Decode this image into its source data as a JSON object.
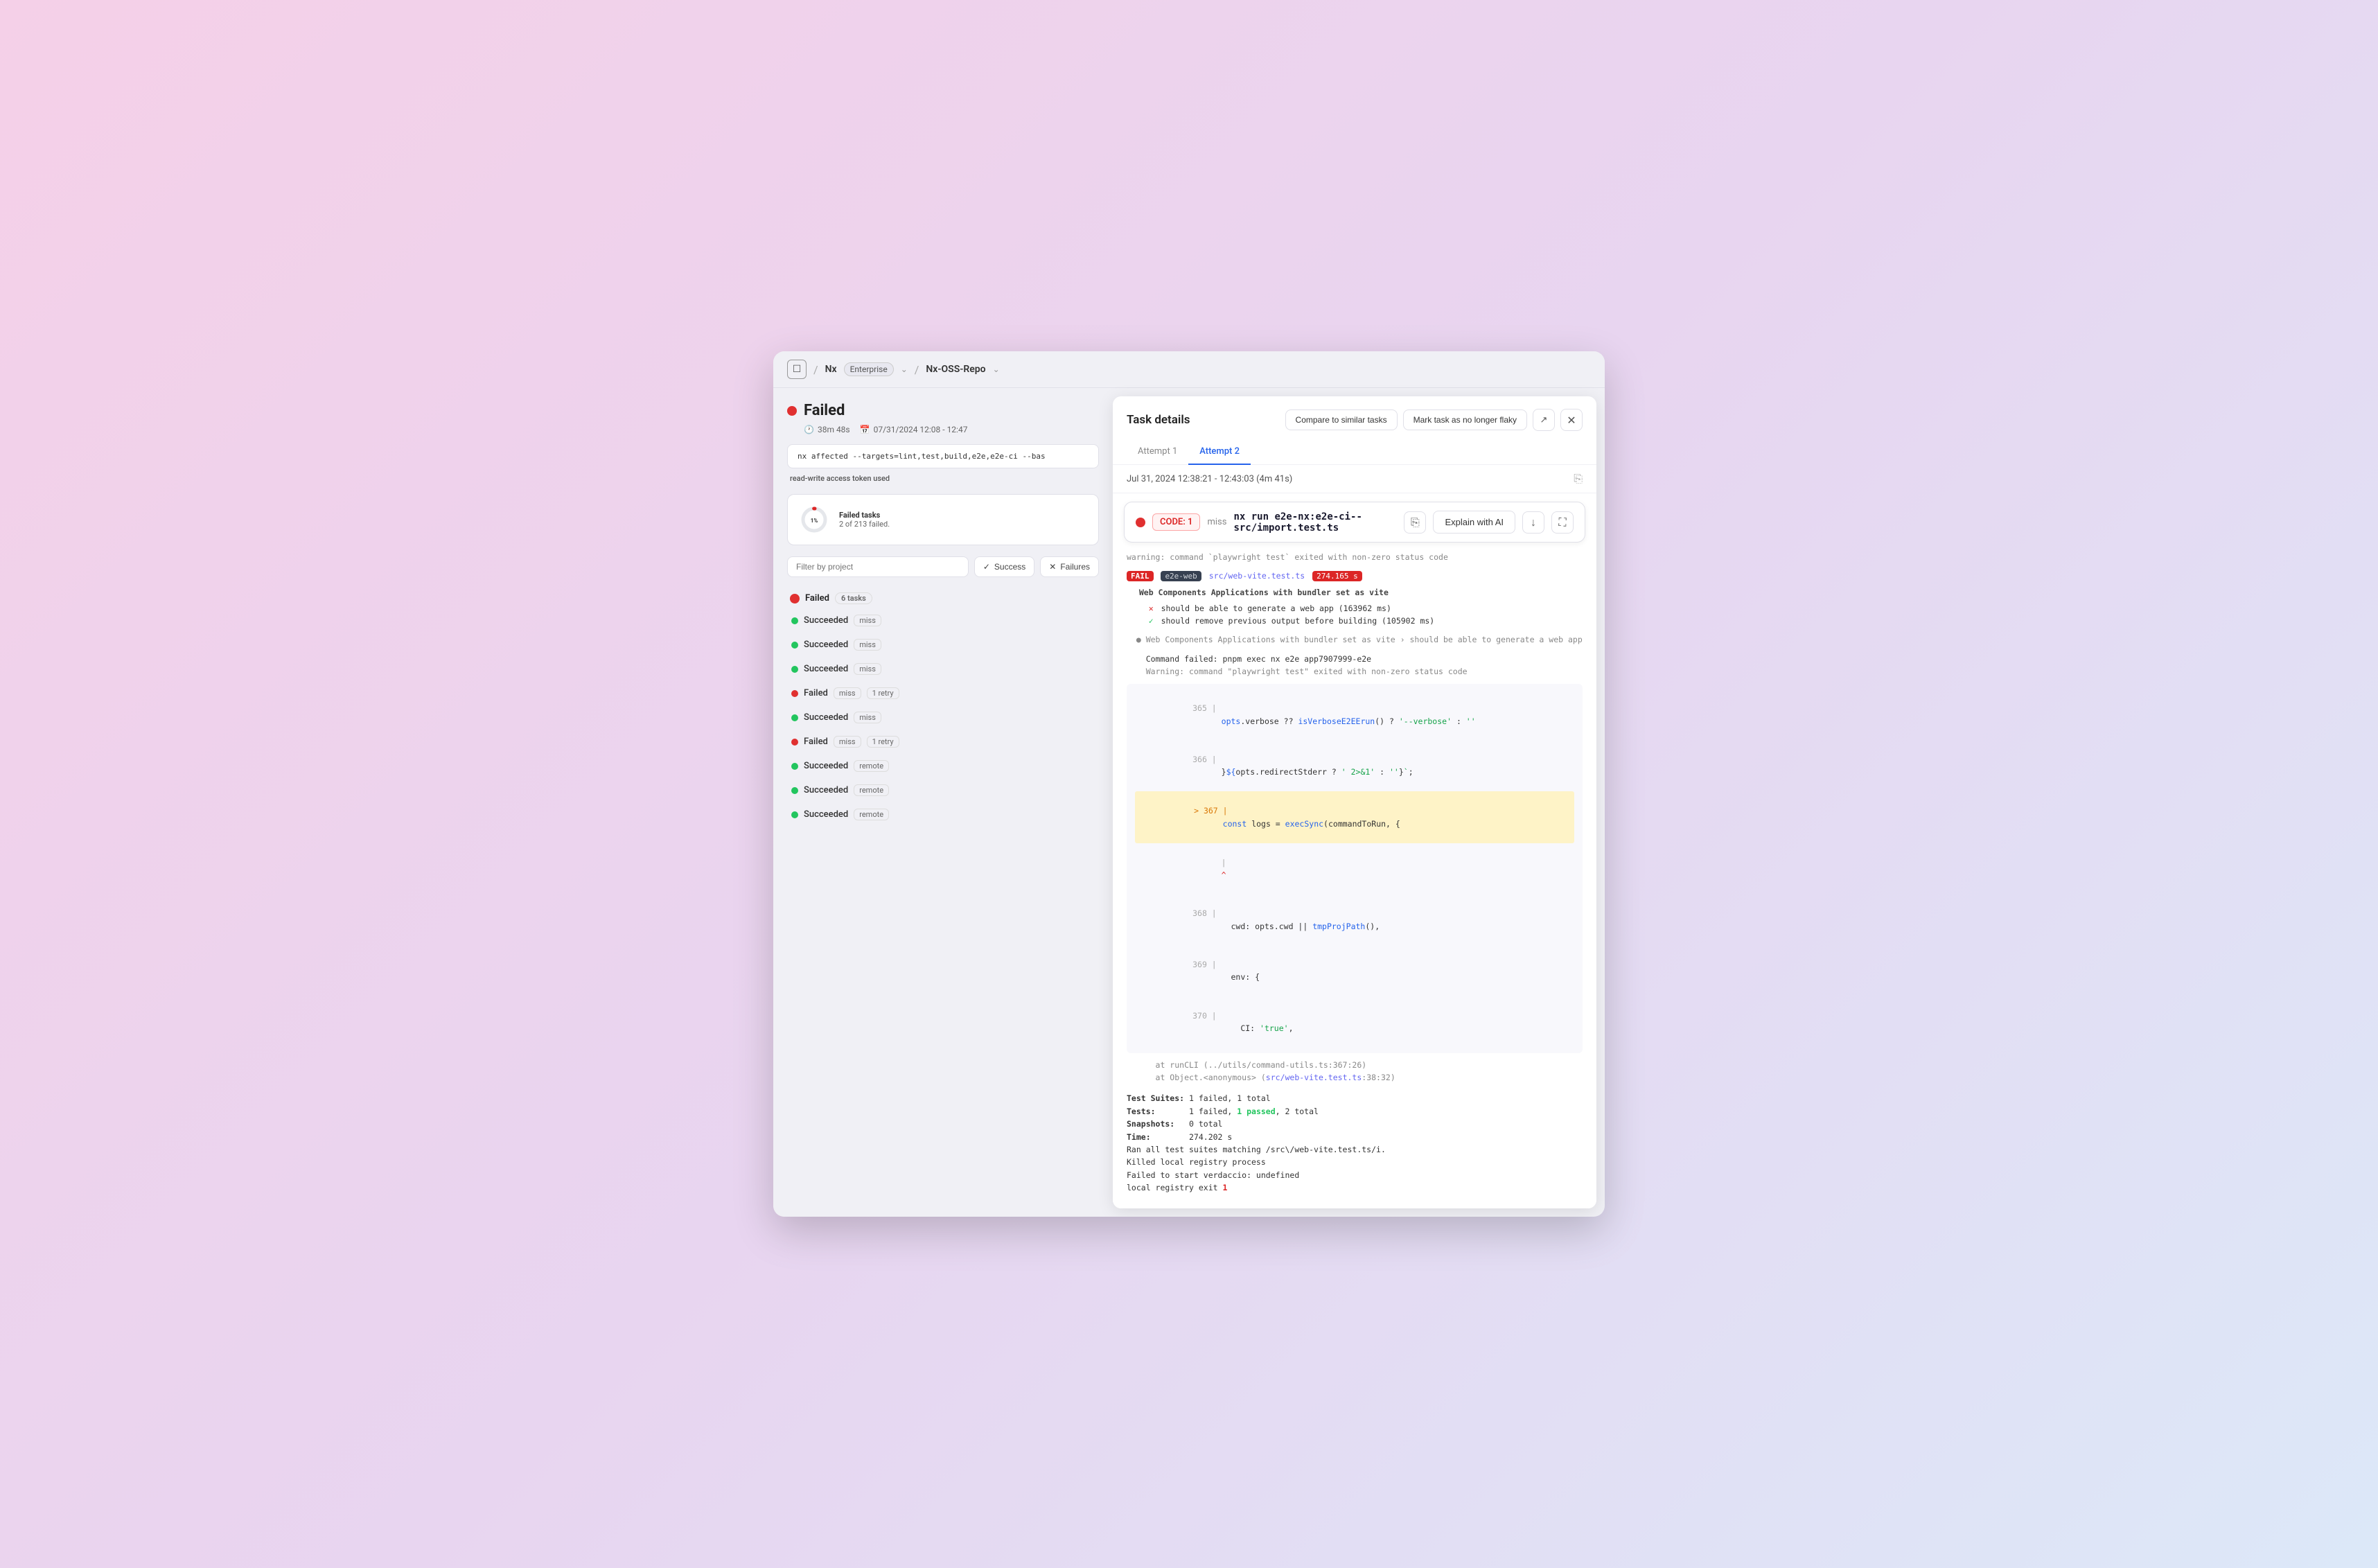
{
  "header": {
    "logo_label": "☐",
    "sep1": "/",
    "nx_label": "Nx",
    "nx_badge": "Enterprise",
    "sep2": "/",
    "repo_label": "Nx-OSS-Repo",
    "chevron": "⌄"
  },
  "pipeline": {
    "status": "Failed",
    "duration": "38m 48s",
    "date": "07/31/2024 12:08 - 12:47",
    "command": "nx affected --targets=lint,test,build,e2e,e2e-ci --bas",
    "token_info": "read-write access token used"
  },
  "failed_tasks": {
    "percent": "1%",
    "title": "Failed tasks",
    "subtitle": "2 of 213 failed."
  },
  "filters": {
    "placeholder": "Filter by project",
    "success_label": "Success",
    "failures_label": "Failures"
  },
  "task_list": {
    "section_label": "Failed",
    "task_count": "6 tasks",
    "items": [
      {
        "status": "succeeded",
        "label": "Succeeded",
        "tags": [
          "miss"
        ]
      },
      {
        "status": "succeeded",
        "label": "Succeeded",
        "tags": [
          "miss"
        ]
      },
      {
        "status": "succeeded",
        "label": "Succeeded",
        "tags": [
          "miss"
        ]
      },
      {
        "status": "failed",
        "label": "Failed",
        "tags": [
          "miss",
          "1 retry"
        ]
      },
      {
        "status": "succeeded",
        "label": "Succeeded",
        "tags": [
          "miss"
        ]
      },
      {
        "status": "failed",
        "label": "Failed",
        "tags": [
          "miss",
          "1 retry"
        ]
      },
      {
        "status": "succeeded",
        "label": "Succeeded",
        "tags": [
          "remote"
        ]
      },
      {
        "status": "succeeded",
        "label": "Succeeded",
        "tags": [
          "remote"
        ]
      },
      {
        "status": "succeeded",
        "label": "Succeeded",
        "tags": [
          "remote"
        ]
      }
    ]
  },
  "task_details": {
    "panel_title": "Task details",
    "compare_btn": "Compare to similar tasks",
    "mark_btn": "Mark task as no longer flaky",
    "tabs": [
      "Attempt 1",
      "Attempt 2"
    ],
    "active_tab": 1,
    "timestamp": "Jul 31, 2024 12:38:21 - 12:43:03 (4m 41s)"
  },
  "command_bar": {
    "code_label": "CODE: 1",
    "miss_label": "miss",
    "command": "nx run e2e-nx:e2e-ci--src/import.test.ts",
    "explain_label": "Explain with AI",
    "copy_icon": "⎘",
    "download_icon": "↓",
    "expand_icon": "⛶"
  },
  "code_output": {
    "warning_line": "warning: command `playwright test` exited with non-zero status code",
    "fail_badge": "FAIL",
    "e2e_badge": "e2e-web",
    "file_path": "src/web-vite.test.ts",
    "time_value": "274.165 s",
    "suite_title": "Web Components Applications with bundler set as vite",
    "test_fail1": "should be able to generate a web app (163962 ms)",
    "test_pass1": "should remove previous output before building (105902 ms)",
    "dot_test": "Web Components Applications with bundler set as vite › should be able to generate a web app",
    "cmd_failed": "Command failed: pnpm exec nx e2e app7907999-e2e",
    "warning2": "Warning: command \"playwright test\" exited with non-zero status code",
    "line365": "opts.verbose ?? isVerboseE2EErun() ? '--verbose' : ''",
    "line366": "}${opts.redirectStderr ? ' 2>&1 : ''}`;",
    "line367": "const logs = execSync(commandToRun, {",
    "line367_arrow": "^",
    "line368": "cwd: opts.cwd || tmpProjPath(),",
    "line369": "env: {",
    "line370": "CI: 'true',",
    "trace1": "at runCLI (../utils/command-utils.ts:367:26)",
    "trace2": "at Object.<anonymous> (src/web-vite.test.ts:38:32)",
    "suites_label": "Test Suites:",
    "suites_val": "1 failed, 1 total",
    "tests_label": "Tests:",
    "tests_val_fail": "1 failed,",
    "tests_val_pass": "1 passed, 2 total",
    "snapshots_label": "Snapshots:",
    "snapshots_val": "0 total",
    "time_label": "Time:",
    "time_val": "274.202 s",
    "ran_line": "Ran all test suites matching /src\\/web-vite.test.ts/i.",
    "killed_line": "Killed local registry process",
    "failed_start": "Failed to start verdaccio: undefined",
    "exit_line_prefix": "local registry exit ",
    "exit_val": "1"
  }
}
